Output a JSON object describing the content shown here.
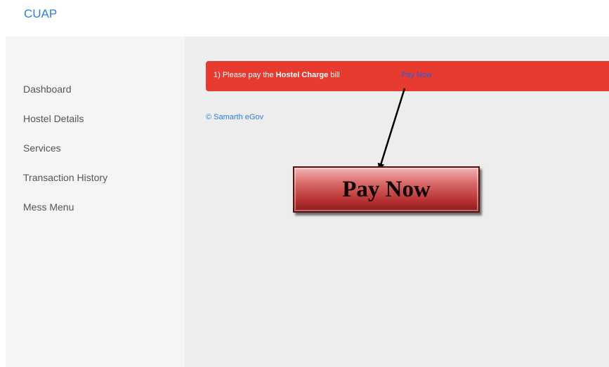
{
  "header": {
    "brand": "CUAP"
  },
  "sidebar": {
    "items": [
      {
        "label": "Dashboard"
      },
      {
        "label": "Hostel Details"
      },
      {
        "label": "Services"
      },
      {
        "label": "Transaction History"
      },
      {
        "label": "Mess Menu"
      }
    ]
  },
  "alert": {
    "prefix": "1) Please pay the ",
    "bold_text": "Hostel Charge",
    "suffix": " bill",
    "link_label": "Pay Now",
    "background_color": "#e63b2e"
  },
  "footer": {
    "copyright": "© Samarth eGov"
  },
  "annotation": {
    "button_label": "Pay Now",
    "icon": "arrow-down-icon"
  }
}
